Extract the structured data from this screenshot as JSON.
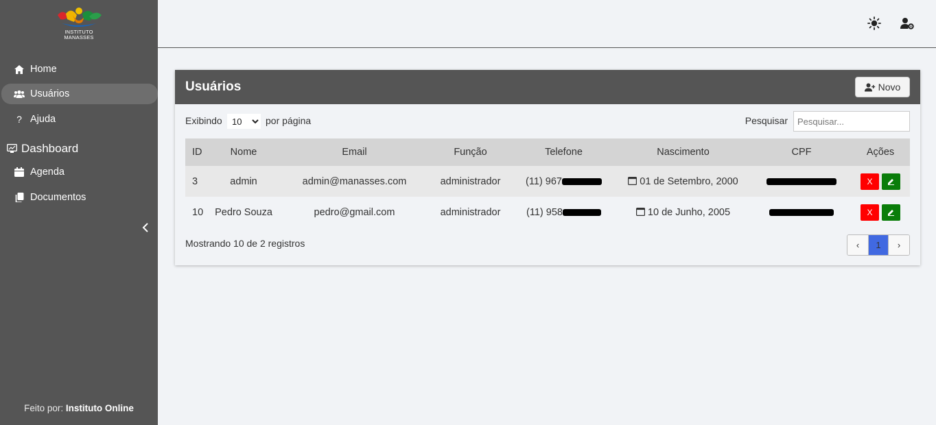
{
  "brand": {
    "logo_text_1": "INSTITUTO",
    "logo_text_2": "MANASSES"
  },
  "sidebar": {
    "items": [
      {
        "label": "Home",
        "icon": "home-icon"
      },
      {
        "label": "Usuários",
        "icon": "users-icon",
        "active": true
      },
      {
        "label": "Ajuda",
        "icon": "question-icon"
      }
    ],
    "section": {
      "label": "Dashboard",
      "icon": "dashboard-icon"
    },
    "section_items": [
      {
        "label": "Agenda",
        "icon": "calendar-icon"
      },
      {
        "label": "Documentos",
        "icon": "documents-icon"
      }
    ],
    "footer_prefix": "Feito por:",
    "footer_brand": "Instituto Online"
  },
  "header": {
    "theme_icon": "sun-icon",
    "user_icon": "user-settings-icon"
  },
  "card": {
    "title": "Usuários",
    "new_button": "Novo",
    "show_label": "Exibindo",
    "per_page_value": "10",
    "per_page_label": "por página",
    "search_label": "Pesquisar",
    "search_placeholder": "Pesquisar...",
    "columns": [
      "ID",
      "Nome",
      "Email",
      "Função",
      "Telefone",
      "Nascimento",
      "CPF",
      "Ações"
    ],
    "rows": [
      {
        "id": "3",
        "nome": "admin",
        "email": "admin@manasses.com",
        "funcao": "administrador",
        "telefone": "(11) 967",
        "nascimento": "01 de Setembro, 2000"
      },
      {
        "id": "10",
        "nome": "Pedro Souza",
        "email": "pedro@gmail.com",
        "funcao": "administrador",
        "telefone": "(11) 958",
        "nascimento": "10 de Junho, 2005"
      }
    ],
    "delete_label": "X",
    "footer_text": "Mostrando 10 de 2 registros",
    "pagination": {
      "prev": "‹",
      "current": "1",
      "next": "›"
    }
  },
  "colors": {
    "sidebar": "#555555",
    "accent_blue": "#4169e1",
    "delete": "#ff0000",
    "edit": "#0a7d0a"
  }
}
